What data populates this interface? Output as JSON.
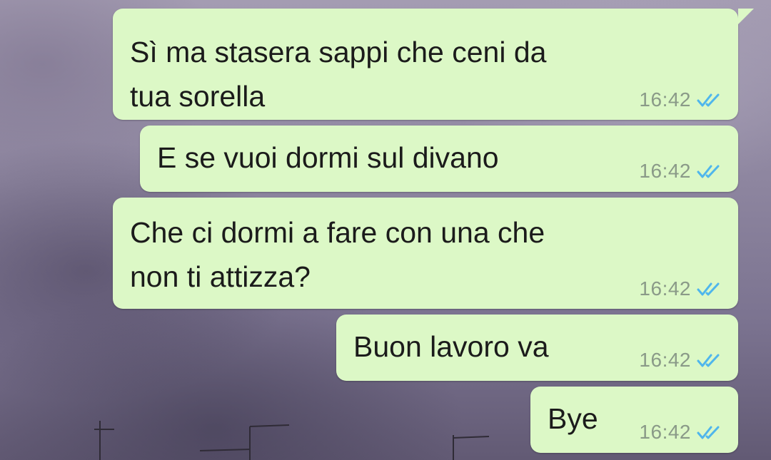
{
  "messages": [
    {
      "lines": [
        "Sì ma stasera sappi che ceni da",
        "tua sorella"
      ],
      "time": "16:42",
      "status_icon": "double-check-read-icon"
    },
    {
      "lines": [
        "E se vuoi dormi sul divano"
      ],
      "time": "16:42",
      "status_icon": "double-check-read-icon"
    },
    {
      "lines": [
        "Che ci dormi a fare con una che",
        "non ti attizza?"
      ],
      "time": "16:42",
      "status_icon": "double-check-read-icon"
    },
    {
      "lines": [
        "Buon lavoro va"
      ],
      "time": "16:42",
      "status_icon": "double-check-read-icon"
    },
    {
      "lines": [
        "Bye"
      ],
      "time": "16:42",
      "status_icon": "double-check-read-icon"
    }
  ],
  "colors": {
    "bubble_outgoing": "#dcf8c6",
    "read_ticks": "#4fb6ec",
    "time_text": "#8a9a88"
  }
}
